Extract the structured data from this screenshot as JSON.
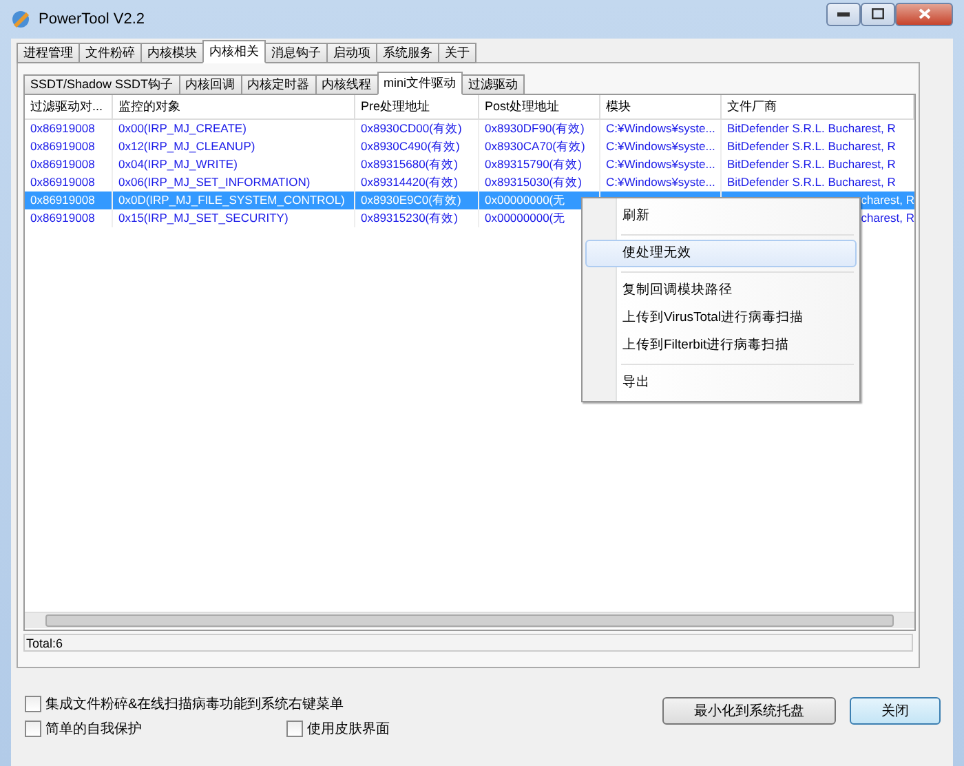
{
  "window": {
    "title": "PowerTool V2.2"
  },
  "tabs": [
    {
      "label": "进程管理",
      "selected": false
    },
    {
      "label": "文件粉碎",
      "selected": false
    },
    {
      "label": "内核模块",
      "selected": false
    },
    {
      "label": "内核相关",
      "selected": true
    },
    {
      "label": "消息钩子",
      "selected": false
    },
    {
      "label": "启动项",
      "selected": false
    },
    {
      "label": "系统服务",
      "selected": false
    },
    {
      "label": "关于",
      "selected": false
    }
  ],
  "subtabs": [
    {
      "label": "SSDT/Shadow SSDT钩子",
      "selected": false
    },
    {
      "label": "内核回调",
      "selected": false
    },
    {
      "label": "内核定时器",
      "selected": false
    },
    {
      "label": "内核线程",
      "selected": false
    },
    {
      "label": "mini文件驱动",
      "selected": true
    },
    {
      "label": "过滤驱动",
      "selected": false
    }
  ],
  "table": {
    "columns": [
      "过滤驱动对...",
      "监控的对象",
      "Pre处理地址",
      "Post处理地址",
      "模块",
      "文件厂商"
    ],
    "rows": [
      {
        "selected": false,
        "cells": [
          "0x86919008",
          "0x00(IRP_MJ_CREATE)",
          "0x8930CD00(有效)",
          "0x8930DF90(有效)",
          "C:¥Windows¥syste...",
          "BitDefender S.R.L. Bucharest, R"
        ]
      },
      {
        "selected": false,
        "cells": [
          "0x86919008",
          "0x12(IRP_MJ_CLEANUP)",
          "0x8930C490(有效)",
          "0x8930CA70(有效)",
          "C:¥Windows¥syste...",
          "BitDefender S.R.L. Bucharest, R"
        ]
      },
      {
        "selected": false,
        "cells": [
          "0x86919008",
          "0x04(IRP_MJ_WRITE)",
          "0x89315680(有效)",
          "0x89315790(有效)",
          "C:¥Windows¥syste...",
          "BitDefender S.R.L. Bucharest, R"
        ]
      },
      {
        "selected": false,
        "cells": [
          "0x86919008",
          "0x06(IRP_MJ_SET_INFORMATION)",
          "0x89314420(有效)",
          "0x89315030(有效)",
          "C:¥Windows¥syste...",
          "BitDefender S.R.L. Bucharest, R"
        ]
      },
      {
        "selected": true,
        "cells": [
          "0x86919008",
          "0x0D(IRP_MJ_FILE_SYSTEM_CONTROL)",
          "0x8930E9C0(有效)",
          "0x00000000(无",
          null,
          "charest, R"
        ]
      },
      {
        "selected": false,
        "cells": [
          "0x86919008",
          "0x15(IRP_MJ_SET_SECURITY)",
          "0x89315230(有效)",
          "0x00000000(无",
          null,
          "charest, R"
        ]
      }
    ]
  },
  "context_menu": [
    {
      "kind": "item",
      "label": "刷新",
      "selected": false
    },
    {
      "kind": "separator"
    },
    {
      "kind": "item",
      "label": "使处理无效",
      "selected": true
    },
    {
      "kind": "separator"
    },
    {
      "kind": "item",
      "label": "复制回调模块路径",
      "selected": false
    },
    {
      "kind": "item",
      "label": "上传到VirusTotal进行病毒扫描",
      "selected": false
    },
    {
      "kind": "item",
      "label": "上传到Filterbit进行病毒扫描",
      "selected": false
    },
    {
      "kind": "separator"
    },
    {
      "kind": "item",
      "label": "导出",
      "selected": false
    }
  ],
  "status_bar": "Total:6",
  "options": [
    {
      "label": "集成文件粉碎&在线扫描病毒功能到系统右键菜单",
      "checked": false
    },
    {
      "label": "简单的自我保护",
      "checked": false
    },
    {
      "label": "使用皮肤界面",
      "checked": false
    }
  ],
  "buttons": [
    {
      "label": "最小化到系统托盘",
      "default": false
    },
    {
      "label": "关闭",
      "default": true
    }
  ]
}
